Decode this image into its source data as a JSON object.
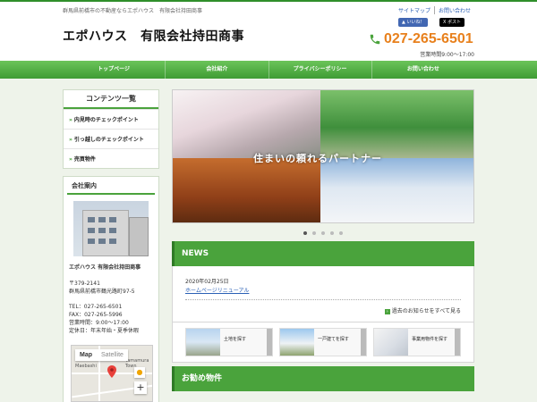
{
  "header": {
    "tagline": "群馬県前橋市の不動産ならエポハウス　有限会社持田商事",
    "title": "エポハウス　有限会社持田商事",
    "links": [
      "サイトマップ",
      "お問い合わせ"
    ],
    "social": {
      "facebook": "いいね！",
      "x": "ポスト"
    },
    "phone": "027-265-6501",
    "hours": "営業時間9:00～17:00"
  },
  "nav": [
    "トップページ",
    "会社紹介",
    "プライバシーポリシー",
    "お問い合わせ"
  ],
  "sidebar": {
    "contents_title": "コンテンツ一覧",
    "contents": [
      "内見時のチェックポイント",
      "引っ越しのチェックポイント",
      "売買物件"
    ],
    "company_title": "会社案内",
    "company_name": "エポハウス 有限会社持田商事",
    "address": [
      "〒379-2141",
      "群馬県前橋市鶴光路町97-5"
    ],
    "contact": [
      "TEL：027-265-6501",
      "FAX：027-265-5996",
      "営業時間：9:00～17:00",
      "定休日：年末年始・夏季休暇"
    ],
    "map": {
      "tab_map": "Map",
      "tab_sat": "Satellite",
      "label1": "Maebashi",
      "label2": "Tamamura Town"
    }
  },
  "slider": {
    "caption": "住まいの頼れるパートナー",
    "dots": 5,
    "active": 0
  },
  "news": {
    "title": "NEWS",
    "date": "2020年02月25日",
    "item": "ホームページリニューアル",
    "more": "過去のお知らせをすべて見る"
  },
  "categories": [
    "土地を探す",
    "一戸建てを探す",
    "事業用物件を探す"
  ],
  "recommend": {
    "title": "お勧め物件"
  },
  "colors": {
    "brand_green": "#4aa33c",
    "phone_orange": "#e8801c",
    "link_blue": "#2b60b5"
  }
}
